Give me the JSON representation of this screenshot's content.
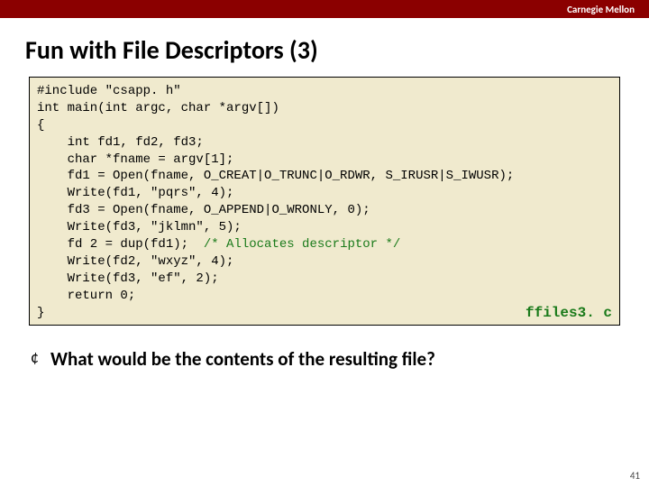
{
  "topbar": {
    "org": "Carnegie Mellon"
  },
  "title": "Fun with File Descriptors (3)",
  "code": {
    "pre1": "#include \"csapp. h\"\nint main(int argc, char *argv[])\n{\n    int fd1, fd2, fd3;\n    char *fname = argv[1];\n    fd1 = Open(fname, O_CREAT|O_TRUNC|O_RDWR, S_IRUSR|S_IWUSR);\n    Write(fd1, \"pqrs\", 4);\n    fd3 = Open(fname, O_APPEND|O_WRONLY, 0);\n    Write(fd3, \"jklmn\", 5);\n    fd 2 = dup(fd1);  ",
    "comment": "/* Allocates descriptor */",
    "pre2": "\n    Write(fd2, \"wxyz\", 4);\n    Write(fd3, \"ef\", 2);\n    return 0;\n}",
    "filestamp": "ffiles3. c"
  },
  "bullet": {
    "mark": "¢",
    "text": "What would be the contents of the resulting file?"
  },
  "pagenum": "41"
}
